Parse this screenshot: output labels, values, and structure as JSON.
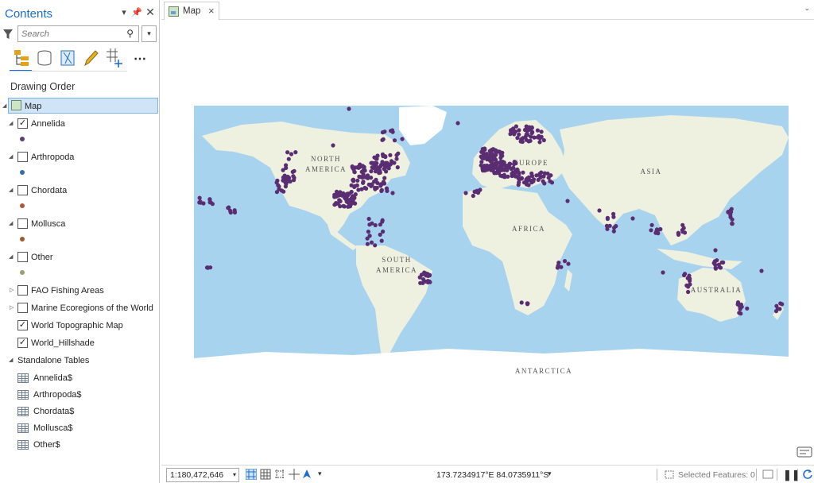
{
  "contents": {
    "title": "Contents",
    "search_placeholder": "Search",
    "section_title": "Drawing Order",
    "map_label": "Map",
    "layers": [
      {
        "label": "Annelida",
        "checked": true,
        "symbol_color": "#5e3c7a"
      },
      {
        "label": "Arthropoda",
        "checked": false,
        "symbol_color": "#2f6da8"
      },
      {
        "label": "Chordata",
        "checked": false,
        "symbol_color": "#b0573a"
      },
      {
        "label": "Mollusca",
        "checked": false,
        "symbol_color": "#a05a2c"
      },
      {
        "label": "Other",
        "checked": false,
        "symbol_color": "#9aa071"
      }
    ],
    "groups": [
      {
        "label": "FAO Fishing Areas",
        "checked": false
      },
      {
        "label": "Marine Ecoregions of the World",
        "checked": false
      },
      {
        "label": "World Topographic Map",
        "checked": true
      },
      {
        "label": "World_Hillshade",
        "checked": true
      }
    ],
    "standalone_title": "Standalone Tables",
    "tables": [
      "Annelida$",
      "Arthropoda$",
      "Chordata$",
      "Mollusca$",
      "Other$"
    ]
  },
  "map_tab": {
    "label": "Map"
  },
  "map": {
    "labels": {
      "north_america": [
        "NORTH",
        "AMERICA"
      ],
      "south_america": [
        "SOUTH",
        "AMERICA"
      ],
      "europe": "EUROPE",
      "asia": "ASIA",
      "africa": "AFRICA",
      "australia": "AUSTRALIA",
      "antarctica": "ANTARCTICA"
    },
    "colors": {
      "ocean": "#a8d3ef",
      "land": "#eef0e0",
      "ice": "#ffffff",
      "points": "#5a2d73"
    }
  },
  "statusbar": {
    "scale": "1:180,472,646",
    "coordinates": "173.7234917°E 84.0735911°S",
    "selected_features": "Selected Features: 0"
  }
}
